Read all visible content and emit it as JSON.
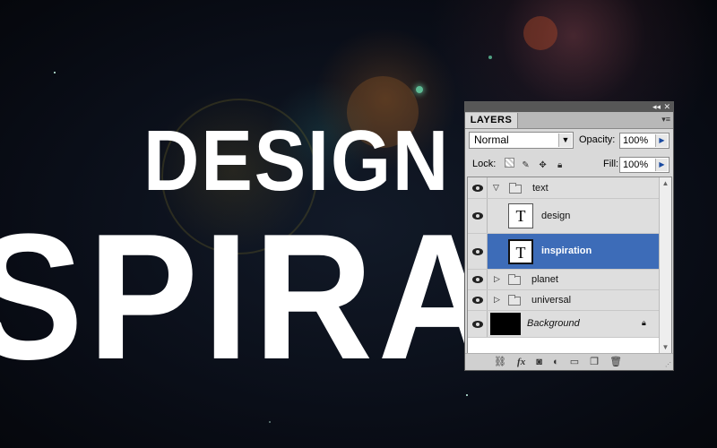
{
  "canvas": {
    "headline": "DESIGN",
    "subline": "SPIRATI"
  },
  "panel": {
    "tab_label": "LAYERS",
    "blend_mode": "Normal",
    "opacity_label": "Opacity:",
    "opacity_value": "100%",
    "lock_label": "Lock:",
    "fill_label": "Fill:",
    "fill_value": "100%",
    "layers": [
      {
        "name": "text",
        "kind": "group",
        "expanded": true,
        "visible": true
      },
      {
        "name": "design",
        "kind": "text",
        "visible": true,
        "thumb": "T"
      },
      {
        "name": "inspiration",
        "kind": "text",
        "visible": true,
        "selected": true,
        "thumb": "T"
      },
      {
        "name": "planet",
        "kind": "group",
        "expanded": false,
        "visible": true
      },
      {
        "name": "universal",
        "kind": "group",
        "expanded": false,
        "visible": true
      },
      {
        "name": "Background",
        "kind": "background",
        "visible": true,
        "locked": true
      }
    ],
    "bottom_icons": [
      "link-icon",
      "fx-icon",
      "mask-icon",
      "adjustment-icon",
      "new-group-icon",
      "new-layer-icon",
      "trash-icon"
    ],
    "fx_label": "fx"
  },
  "colors": {
    "selection": "#3d6cb8",
    "panel_bg": "#d9d9d9"
  }
}
